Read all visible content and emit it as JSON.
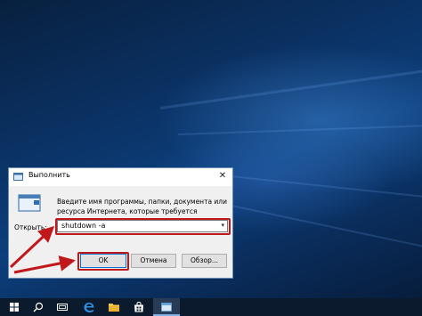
{
  "dialog": {
    "title": "Выполнить",
    "close_label": "✕",
    "description": "Введите имя программы, папки, документа или ресурса Интернета, которые требуется открыть.",
    "open_label": "Открыть:",
    "command_value": "shutdown -a",
    "dropdown_glyph": "▾",
    "buttons": {
      "ok": "OK",
      "cancel": "Отмена",
      "browse": "Обзор..."
    }
  },
  "colors": {
    "highlight": "#c0181b",
    "accent": "#0078d7"
  },
  "taskbar": {
    "items": [
      "start-icon",
      "search-icon",
      "task-view-icon",
      "edge-icon",
      "file-explorer-icon",
      "store-icon",
      "run-app-icon"
    ]
  }
}
